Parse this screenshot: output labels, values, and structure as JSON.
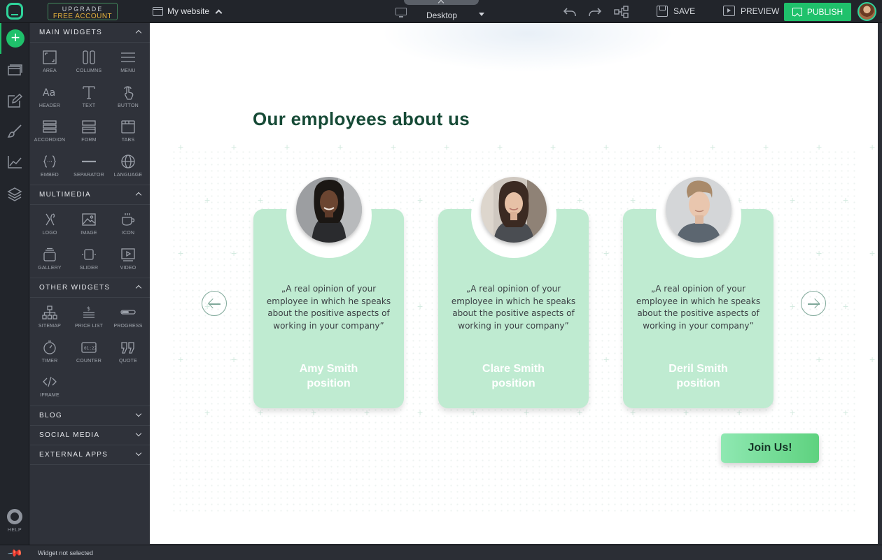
{
  "topbar": {
    "upgrade_line1": "UPGRADE",
    "upgrade_line2": "FREE ACCOUNT",
    "site_name": "My website",
    "device": "Desktop",
    "save_label": "SAVE",
    "preview_label": "PREVIEW",
    "publish_label": "PUBLISH",
    "colors": {
      "accent": "#1fc16b",
      "upgrade_text": "#e6b23c"
    }
  },
  "rail": {
    "items": [
      "add-widget",
      "pages",
      "edit",
      "design",
      "stats",
      "layers"
    ],
    "help_label": "HELP"
  },
  "panel": {
    "sections": [
      {
        "title": "MAIN WIDGETS",
        "expanded": true,
        "widgets": [
          {
            "label": "AREA",
            "icon": "area-icon"
          },
          {
            "label": "COLUMNS",
            "icon": "columns-icon"
          },
          {
            "label": "MENU",
            "icon": "menu-icon"
          },
          {
            "label": "HEADER",
            "icon": "header-icon"
          },
          {
            "label": "TEXT",
            "icon": "text-icon"
          },
          {
            "label": "BUTTON",
            "icon": "button-icon"
          },
          {
            "label": "ACCORDION",
            "icon": "accordion-icon"
          },
          {
            "label": "FORM",
            "icon": "form-icon"
          },
          {
            "label": "TABS",
            "icon": "tabs-icon"
          },
          {
            "label": "EMBED",
            "icon": "embed-icon"
          },
          {
            "label": "SEPARATOR",
            "icon": "separator-icon"
          },
          {
            "label": "LANGUAGE",
            "icon": "globe-icon"
          }
        ]
      },
      {
        "title": "MULTIMEDIA",
        "expanded": true,
        "widgets": [
          {
            "label": "LOGO",
            "icon": "logo-icon"
          },
          {
            "label": "IMAGE",
            "icon": "image-icon"
          },
          {
            "label": "ICON",
            "icon": "cup-icon"
          },
          {
            "label": "GALLERY",
            "icon": "gallery-icon"
          },
          {
            "label": "SLIDER",
            "icon": "slider-icon"
          },
          {
            "label": "VIDEO",
            "icon": "video-icon"
          }
        ]
      },
      {
        "title": "OTHER WIDGETS",
        "expanded": true,
        "widgets": [
          {
            "label": "SITEMAP",
            "icon": "sitemap-icon"
          },
          {
            "label": "PRICE LIST",
            "icon": "price-list-icon"
          },
          {
            "label": "PROGRESS",
            "icon": "progress-icon"
          },
          {
            "label": "TIMER",
            "icon": "timer-icon"
          },
          {
            "label": "COUNTER",
            "icon": "counter-icon"
          },
          {
            "label": "QUOTE",
            "icon": "quote-icon"
          },
          {
            "label": "IFRAME",
            "icon": "iframe-icon"
          }
        ]
      },
      {
        "title": "BLOG",
        "expanded": false,
        "widgets": []
      },
      {
        "title": "SOCIAL MEDIA",
        "expanded": false,
        "widgets": []
      },
      {
        "title": "EXTERNAL APPS",
        "expanded": false,
        "widgets": []
      }
    ]
  },
  "canvas": {
    "title": "Our employees about us",
    "cards": [
      {
        "quote": "„A real opinion of your employee in which he speaks about the positive aspects of working in your company”",
        "name": "Amy Smith",
        "position": "position"
      },
      {
        "quote": "„A real opinion of your employee in which he speaks about the positive aspects of working in your company”",
        "name": "Clare Smith",
        "position": "position"
      },
      {
        "quote": "„A real opinion of your employee in which he speaks about the positive aspects of working in your company”",
        "name": "Deril Smith",
        "position": "position"
      }
    ],
    "join_label": "Join Us!",
    "colors": {
      "card": "#bfebd1",
      "title": "#164a36"
    }
  },
  "status": {
    "text": "Widget not selected"
  }
}
